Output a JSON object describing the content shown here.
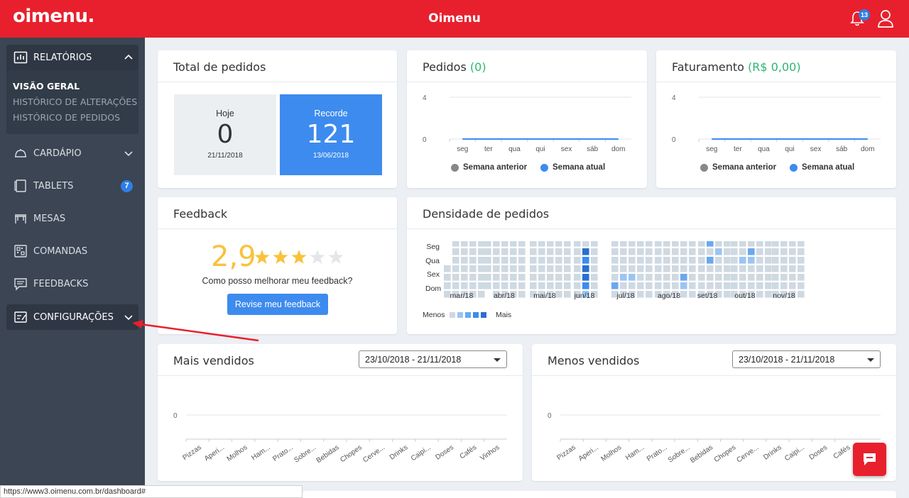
{
  "header": {
    "logo": "oimenu.",
    "title": "Oimenu",
    "notifications_count": "13"
  },
  "sidebar": {
    "relatorios": "RELATÓRIOS",
    "sub_items": [
      "VISÃO GERAL",
      "HISTÓRICO DE ALTERAÇÕES",
      "HISTÓRICO DE PEDIDOS"
    ],
    "items": [
      {
        "label": "CARDÁPIO"
      },
      {
        "label": "TABLETS",
        "badge": "7"
      },
      {
        "label": "MESAS"
      },
      {
        "label": "COMANDAS"
      },
      {
        "label": "FEEDBACKS"
      },
      {
        "label": "CONFIGURAÇÕES"
      }
    ]
  },
  "total_pedidos": {
    "title": "Total de pedidos",
    "hoje_label": "Hoje",
    "hoje_value": "0",
    "hoje_date": "21/11/2018",
    "recorde_label": "Recorde",
    "recorde_value": "121",
    "recorde_date": "13/06/2018"
  },
  "pedidos_card": {
    "title": "Pedidos",
    "title_value": "(0)",
    "legend_prev": "Semana anterior",
    "legend_curr": "Semana atual"
  },
  "faturamento_card": {
    "title": "Faturamento",
    "title_value": "(R$ 0,00)",
    "legend_prev": "Semana anterior",
    "legend_curr": "Semana atual"
  },
  "feedback": {
    "title": "Feedback",
    "rating": "2,9",
    "stars": 2.9,
    "question": "Como posso melhorar meu feedback?",
    "button": "Revise meu feedback"
  },
  "densidade": {
    "title": "Densidade de pedidos",
    "row_labels": [
      "Seg",
      "Qua",
      "Sex",
      "Dom"
    ],
    "months": [
      "mar/18",
      "abr/18",
      "mai/18",
      "jun/18",
      "jul/18",
      "ago/18",
      "set/18",
      "out/18",
      "nov/18"
    ],
    "legend_less": "Menos",
    "legend_more": "Mais"
  },
  "mais_vendidos": {
    "title": "Mais vendidos",
    "range": "23/10/2018 - 21/11/2018"
  },
  "menos_vendidos": {
    "title": "Menos vendidos",
    "range": "23/10/2018 - 21/11/2018"
  },
  "status_url": "https://www3.oimenu.com.br/dashboard#",
  "colors": {
    "brand": "#e8202d",
    "accent": "#3d8bee",
    "sidebar": "#3b4553",
    "positive": "#2bb673"
  },
  "chart_data": [
    {
      "type": "line",
      "categories": [
        "seg",
        "ter",
        "qua",
        "qui",
        "sex",
        "sáb",
        "dom"
      ],
      "series": [
        {
          "name": "Semana anterior",
          "values": [
            0,
            0,
            0,
            0,
            0,
            0,
            0
          ]
        },
        {
          "name": "Semana atual",
          "values": [
            0,
            0,
            0,
            0,
            0,
            0,
            0
          ]
        }
      ],
      "yticks": [
        "0",
        "4"
      ],
      "ylim": [
        0,
        4
      ]
    },
    {
      "type": "line",
      "categories": [
        "seg",
        "ter",
        "qua",
        "qui",
        "sex",
        "sáb",
        "dom"
      ],
      "series": [
        {
          "name": "Semana anterior",
          "values": [
            0,
            0,
            0,
            0,
            0,
            0,
            0
          ]
        },
        {
          "name": "Semana atual",
          "values": [
            0,
            0,
            0,
            0,
            0,
            0,
            0
          ]
        }
      ],
      "yticks": [
        "0",
        "4"
      ],
      "ylim": [
        0,
        4
      ]
    },
    {
      "type": "bar",
      "categories": [
        "Pizzas",
        "Aperi...",
        "Molhos",
        "Ham...",
        "Prato...",
        "Sobre...",
        "Bebidas",
        "Chopes",
        "Cerve...",
        "Drinks",
        "Caipi...",
        "Doses",
        "Cafés",
        "Vinhos"
      ],
      "values": [
        0,
        0,
        0,
        0,
        0,
        0,
        0,
        0,
        0,
        0,
        0,
        0,
        0,
        0
      ],
      "yticks": [
        "0"
      ]
    },
    {
      "type": "bar",
      "categories": [
        "Pizzas",
        "Aperi...",
        "Molhos",
        "Ham...",
        "Prato...",
        "Sobre...",
        "Bebidas",
        "Chopes",
        "Cerve...",
        "Drinks",
        "Caipi...",
        "Doses",
        "Cafés"
      ],
      "values": [
        0,
        0,
        0,
        0,
        0,
        0,
        0,
        0,
        0,
        0,
        0,
        0,
        0
      ],
      "yticks": [
        "0"
      ]
    }
  ]
}
